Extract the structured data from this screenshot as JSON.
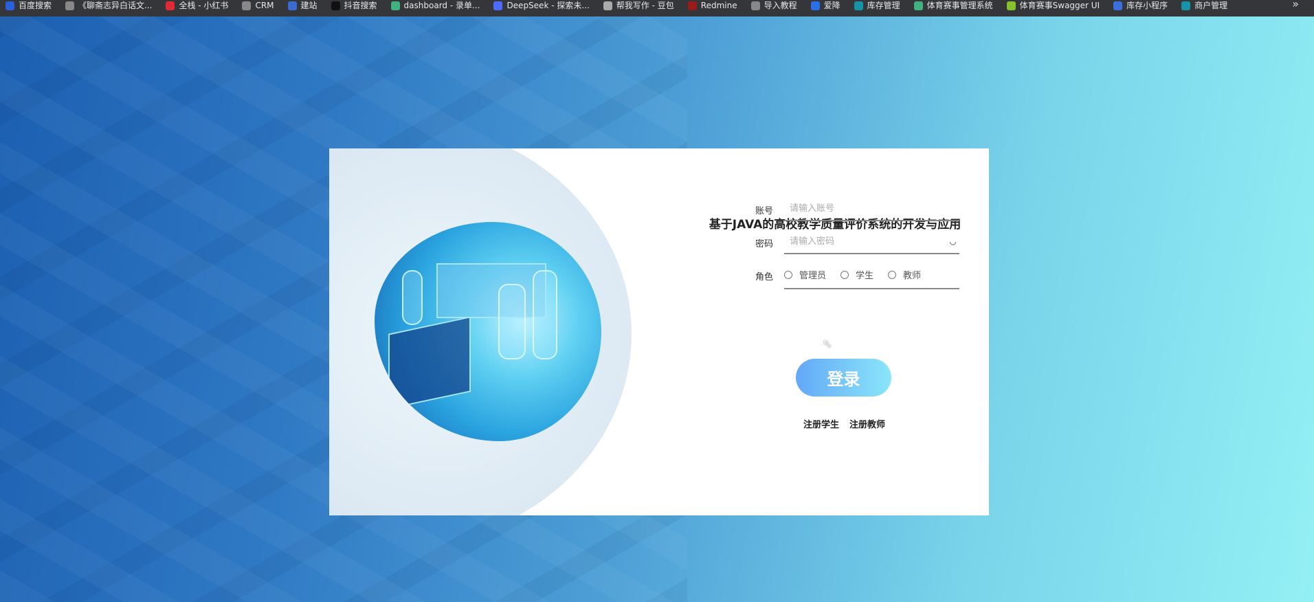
{
  "bookmarks": [
    {
      "label": "百度搜索",
      "color": "#2b5fdc"
    },
    {
      "label": "《聊斋志异白话文...",
      "color": "#888"
    },
    {
      "label": "全栈 - 小红书",
      "color": "#e02a36"
    },
    {
      "label": "CRM",
      "color": "#888"
    },
    {
      "label": "建站",
      "color": "#3a6cd0"
    },
    {
      "label": "抖音搜索",
      "color": "#111"
    },
    {
      "label": "dashboard - 录单...",
      "color": "#3fb27f"
    },
    {
      "label": "DeepSeek - 探索未...",
      "color": "#4d6bfe"
    },
    {
      "label": "帮我写作 - 豆包",
      "color": "#aaa"
    },
    {
      "label": "Redmine",
      "color": "#9b1b1b"
    },
    {
      "label": "导入教程",
      "color": "#888"
    },
    {
      "label": "爱降",
      "color": "#2a6ee8"
    },
    {
      "label": "库存管理",
      "color": "#1793a8"
    },
    {
      "label": "体育赛事管理系统",
      "color": "#3fb27f"
    },
    {
      "label": "体育赛事Swagger UI",
      "color": "#85c22b"
    },
    {
      "label": "库存小程序",
      "color": "#3b6ee0"
    },
    {
      "label": "商户管理",
      "color": "#1793a8"
    }
  ],
  "more": "»",
  "login": {
    "title": "基于JAVA的高校教学质量评价系统的开发与应用",
    "account_label": "账号",
    "account_placeholder": "请输入账号",
    "password_label": "密码",
    "password_placeholder": "请输入密码",
    "role_label": "角色",
    "roles": [
      "管理员",
      "学生",
      "教师"
    ],
    "login_button": "登录",
    "register_student": "注册学生",
    "register_teacher": "注册教师"
  }
}
